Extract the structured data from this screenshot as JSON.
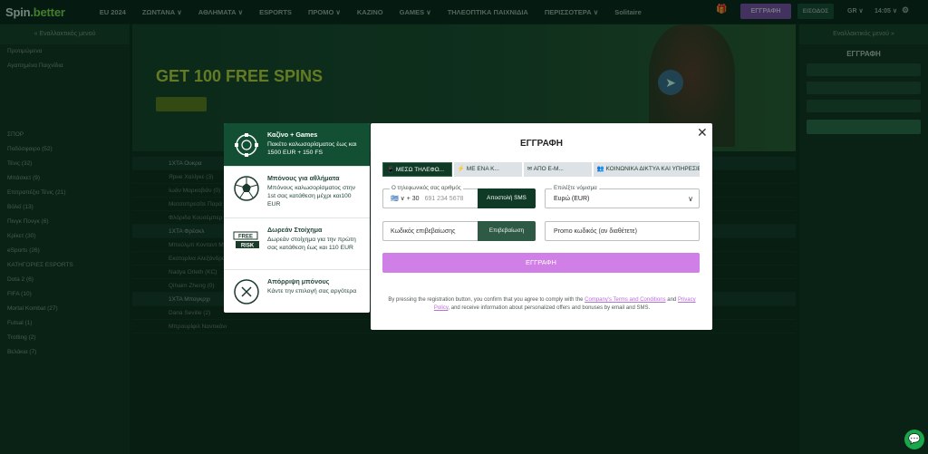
{
  "topbar": {
    "logo_a": "Spin",
    "logo_b": ".better",
    "nav": [
      "EU 2024",
      "ΖΩΝΤΑΝΑ ∨",
      "ΑΘΛΗΜΑΤΑ ∨",
      "ESPORTS",
      "ΠΡΟΜΟ ∨",
      "ΚΑΖΙΝΟ",
      "GAMES ∨",
      "ΤΗΛΕΟΠΤΙΚΑ ΠΑΙΧΝΙΔΙΑ",
      "ΠΕΡΙΣΣΟΤΕΡΑ ∨",
      "Solitaire"
    ],
    "register": "ΕΓΓΡΑΦΗ",
    "login": "ΕΙΣΟΔΟΣ",
    "lang": "GR ∨",
    "clock": "14:05 ∨",
    "gift_icon": "gift-icon",
    "gear_icon": "gear-icon"
  },
  "left": {
    "header": "« Εναλλακτικός μενού",
    "rows": [
      "Προτιμώμενα",
      "Αγαπημένα Παιχνίδια",
      "ΣΠΟΡ",
      "Ποδόσφαιρο (52)",
      "Τένις (32)",
      "Μπάσκετ (9)",
      "Επιτραπέζιο Τένις (21)",
      "Βόλεϊ (13)",
      "Πινγκ Πονγκ (6)",
      "Κρίκετ (30)",
      "eSports (26)",
      "ΚΑΤΗΓΟΡΙΕΣ ESPORTS",
      "Dota 2 (6)",
      "FIFA (10)",
      "Mortal Kombat (27)",
      "Futsal (1)",
      "Trotting (2)",
      "Βελάκια (7)"
    ]
  },
  "banner": {
    "title": "GET 100 FREE SPINS",
    "telegram_icon": "telegram-icon"
  },
  "events": {
    "rows": [
      "1ΧΤΑ Ουκρα",
      "Ярне Χαλίγκε (3)",
      "Ιωάν Μαρκοβιάν (0)",
      "Ματσοπρεσίτε Παρά",
      "Φλόριδα Κουσέμπερ",
      "1ΧΤΑ Φρέσκλ",
      "Μπούλμπ Κονταντ Μπόι",
      "Εκσταρίνα Αλεξάνδρα",
      "Nadya Orleth (KC)",
      "Qihaim Zheng (0)",
      "1ΧΤΑ Μπαγκρχι",
      "Dana Seville (2)",
      "Μπρουρίφιλ Ναντικάνι"
    ]
  },
  "right": {
    "header": "Εναλλακτικός μενού »",
    "title": "ΕΓΓΡΑΦΗ"
  },
  "bonuses": [
    {
      "title": "Καζίνο + Games",
      "desc": "Πακέτο καλωσορίσματος έως και 1500 EUR + 150 FS",
      "icon": "casino-chip-icon"
    },
    {
      "title": "Μπόνους για αθλήματα",
      "desc": "Μπόνους καλωσορίσματος στην 1st σας κατάθεση μέχρι και100 EUR",
      "icon": "football-icon"
    },
    {
      "title": "Δωρεάν Στοίχημα",
      "desc": "Δωρεάν στοίχημα για την πρώτη σας κατάθεση έως και 110 EUR",
      "icon": "free-risk-icon",
      "badge_a": "FREE",
      "badge_b": "RISK"
    },
    {
      "title": "Απόρριψη μπόνους",
      "desc": "Κάντε την επιλογή σας αργότερα",
      "icon": "decline-x-icon"
    }
  ],
  "dialog": {
    "title": "ΕΓΓΡΑΦΗ",
    "close_icon": "close-icon",
    "tabs": [
      "📱 ΜΕΣΩ ΤΗΛΕΦΩ...",
      "⚡ ΜΕ ΕΝΑ Κ...",
      "✉ ΑΠΟ Ε-Μ...",
      "👥 ΚΟΙΝΩΝΙΚΑ ΔΙΚΤΥΑ ΚΑΙ ΥΠΗΡΕΣΙΕΣ ΜΗΝΥ..."
    ],
    "phone_label": "Ο τηλεφωνικός σας αριθμός",
    "phone_code": "+ 30",
    "phone_placeholder": "691 234 5678",
    "sms_button": "Αποστολή SMS",
    "currency_label": "Επιλέξτε νόμισμα",
    "currency_value": "Ευρώ (EUR)",
    "code_placeholder": "Κωδικός επιβεβαίωσης",
    "confirm_button": "Επιβεβαίωση",
    "promo_placeholder": "Promo κωδικός (αν διαθέτετε)",
    "submit": "ΕΓΓΡΑΦΗ",
    "terms_a": "By pressing the registration button, you confirm that you agree to comply with the ",
    "terms_link1": "Company's Terms and Conditions",
    "terms_b": " and ",
    "terms_link2": "Privacy Policy",
    "terms_c": ", and receive information about personalized offers and bonuses by email and SMS."
  },
  "chat_icon": "chat-icon"
}
